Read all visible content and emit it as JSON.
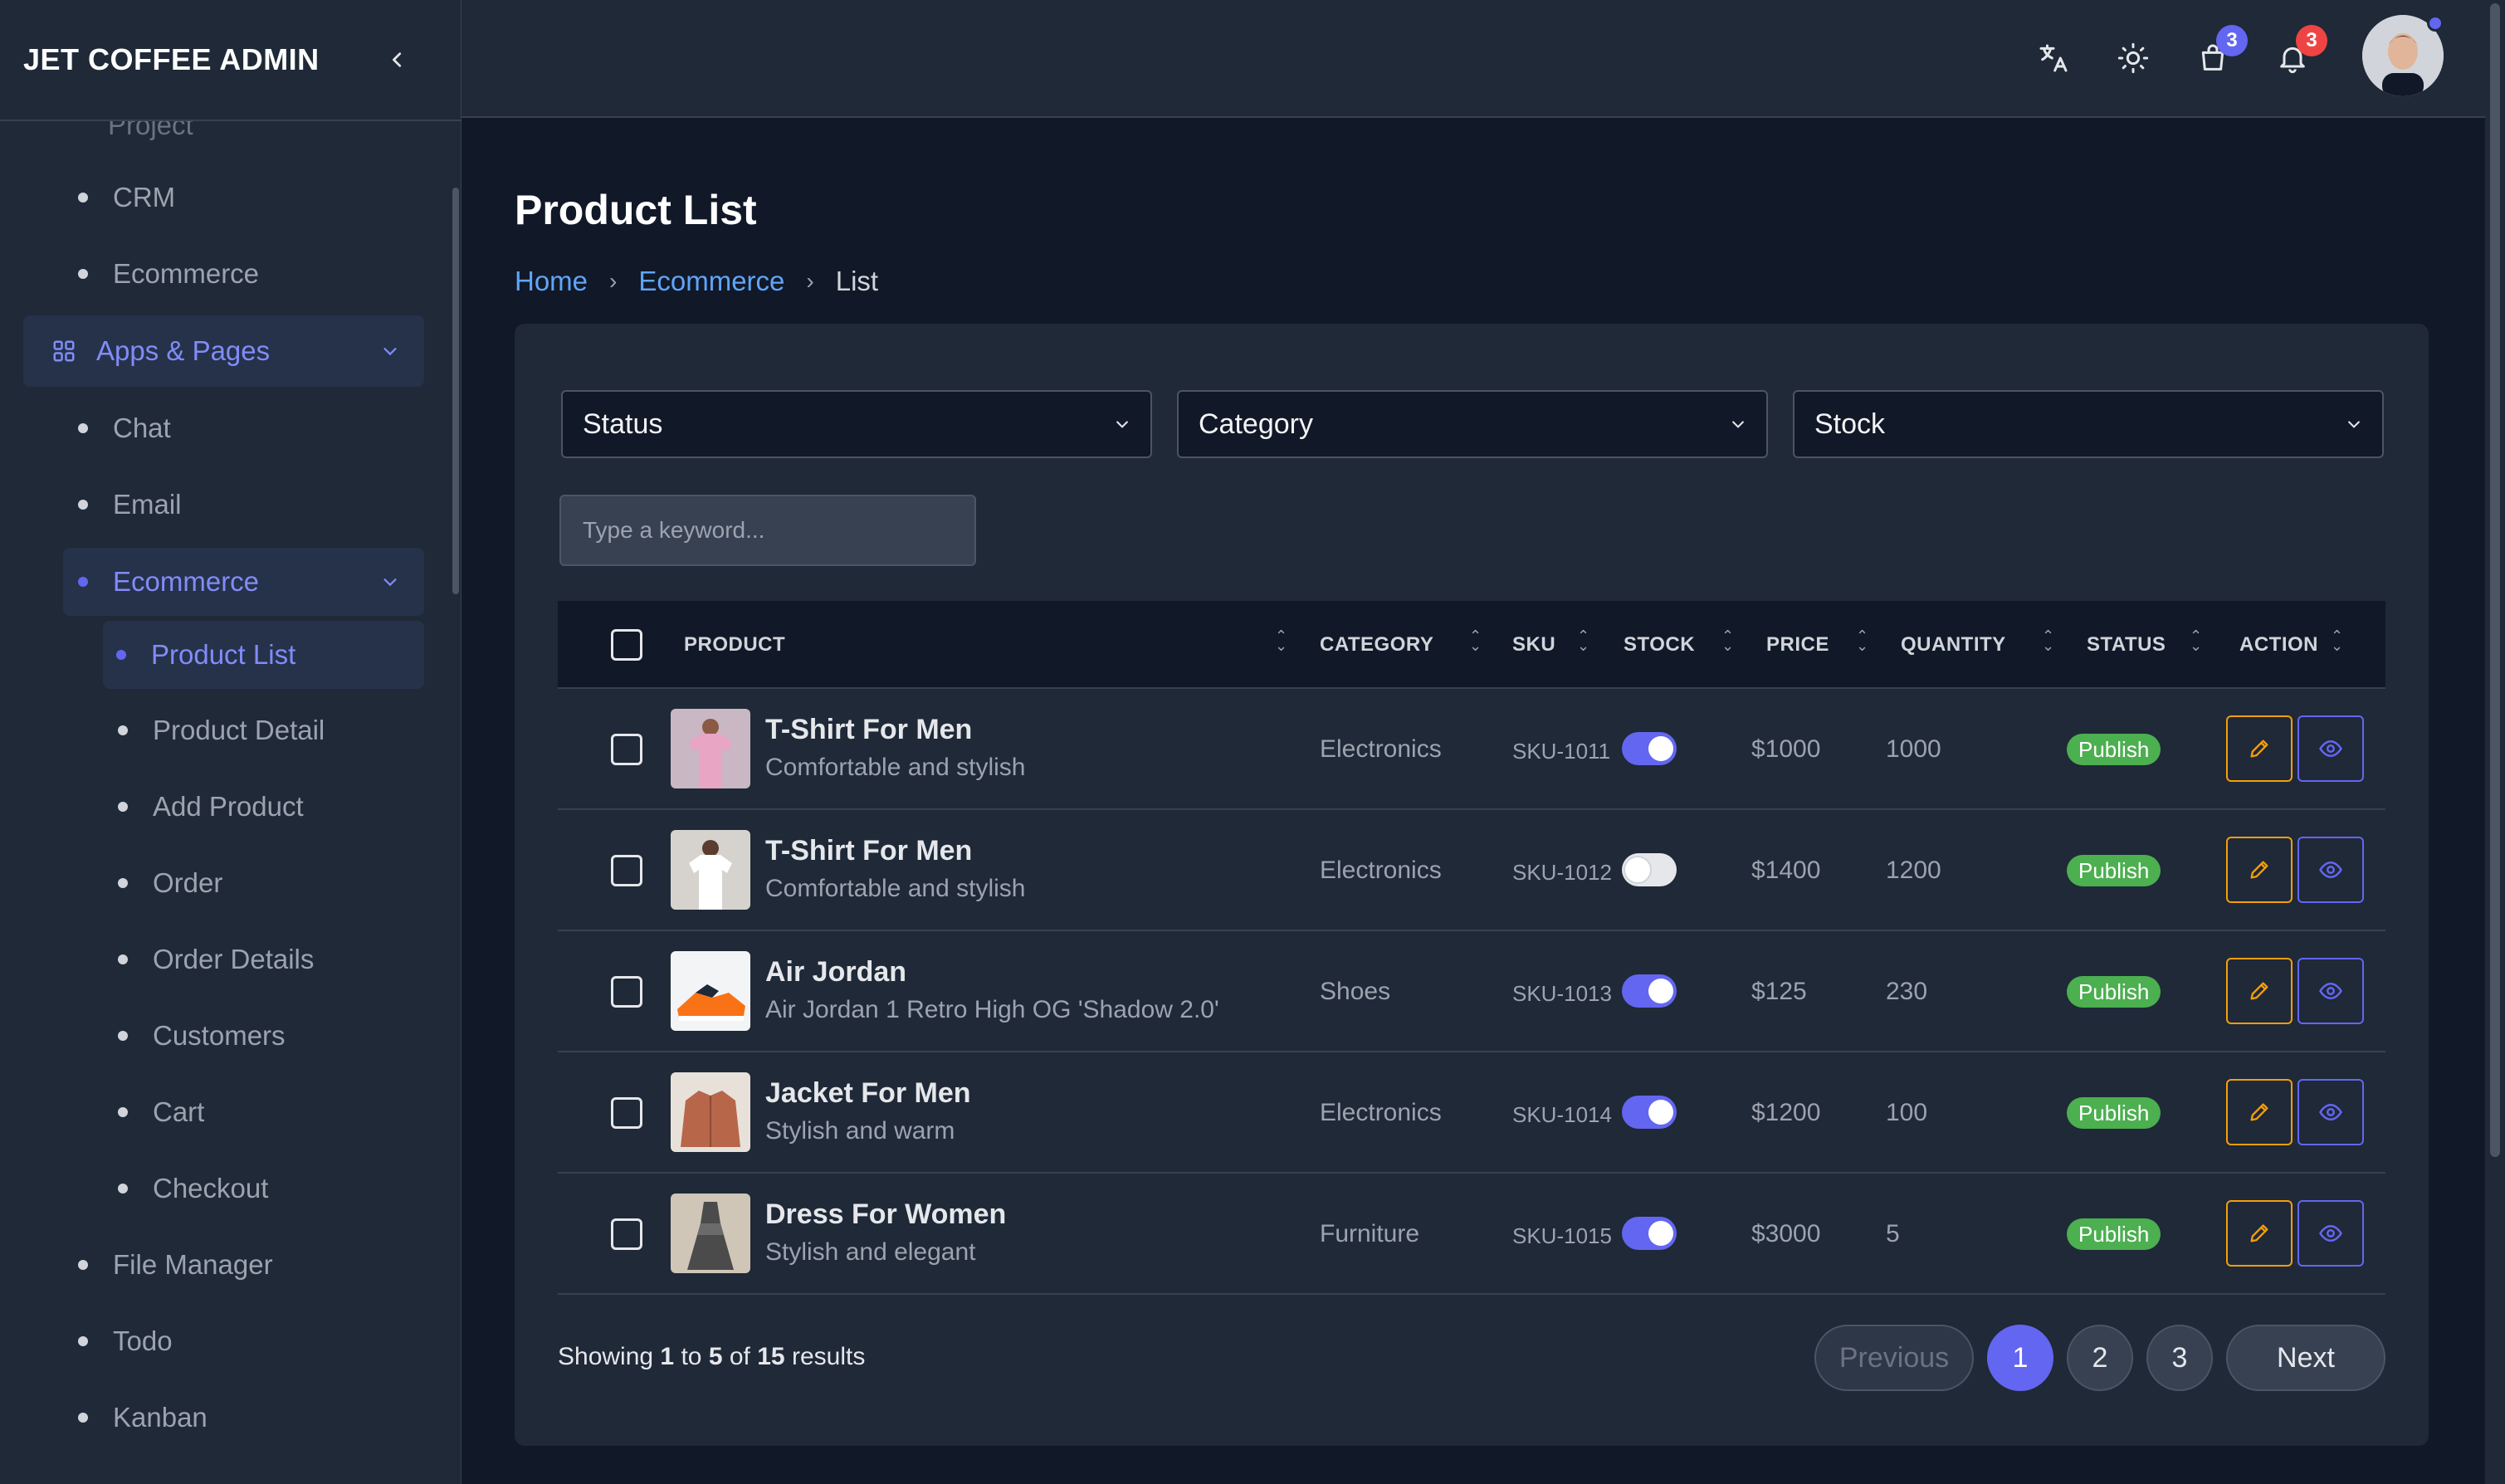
{
  "app": {
    "brand": "JET COFFEE ADMIN"
  },
  "sidebar": {
    "partial_top": "Project",
    "items_top": [
      {
        "label": "CRM"
      },
      {
        "label": "Ecommerce"
      }
    ],
    "group_apps": {
      "label": "Apps & Pages"
    },
    "items_apps": [
      {
        "label": "Chat"
      },
      {
        "label": "Email"
      }
    ],
    "group_ecommerce": {
      "label": "Ecommerce"
    },
    "active_item": {
      "label": "Product List"
    },
    "items_ecommerce": [
      {
        "label": "Product Detail"
      },
      {
        "label": "Add Product"
      },
      {
        "label": "Order"
      },
      {
        "label": "Order Details"
      },
      {
        "label": "Customers"
      },
      {
        "label": "Cart"
      },
      {
        "label": "Checkout"
      }
    ],
    "items_bottom": [
      {
        "label": "File Manager"
      },
      {
        "label": "Todo"
      },
      {
        "label": "Kanban"
      }
    ]
  },
  "topbar": {
    "cart_count": "3",
    "notifications_count": "3",
    "icons": [
      "translate-icon",
      "sun-icon",
      "shopping-bag-icon",
      "bell-icon"
    ]
  },
  "page": {
    "title": "Product List",
    "breadcrumb": {
      "home": "Home",
      "section": "Ecommerce",
      "current": "List"
    }
  },
  "filters": {
    "status": "Status",
    "category": "Category",
    "stock": "Stock",
    "search_placeholder": "Type a keyword..."
  },
  "table": {
    "headers": {
      "product": "PRODUCT",
      "category": "CATEGORY",
      "sku": "SKU",
      "stock": "STOCK",
      "price": "PRICE",
      "quantity": "QUANTITY",
      "status": "STATUS",
      "action": "ACTION"
    },
    "rows": [
      {
        "name": "T-Shirt For Men",
        "desc": "Comfortable and stylish",
        "category": "Electronics",
        "sku": "SKU-1011",
        "stock_on": true,
        "price": "$1000",
        "quantity": "1000",
        "status": "Publish"
      },
      {
        "name": "T-Shirt For Men",
        "desc": "Comfortable and stylish",
        "category": "Electronics",
        "sku": "SKU-1012",
        "stock_on": false,
        "price": "$1400",
        "quantity": "1200",
        "status": "Publish"
      },
      {
        "name": "Air Jordan",
        "desc": "Air Jordan 1 Retro High OG 'Shadow 2.0'",
        "category": "Shoes",
        "sku": "SKU-1013",
        "stock_on": true,
        "price": "$125",
        "quantity": "230",
        "status": "Publish"
      },
      {
        "name": "Jacket For Men",
        "desc": "Stylish and warm",
        "category": "Electronics",
        "sku": "SKU-1014",
        "stock_on": true,
        "price": "$1200",
        "quantity": "100",
        "status": "Publish"
      },
      {
        "name": "Dress For Women",
        "desc": "Stylish and elegant",
        "category": "Furniture",
        "sku": "SKU-1015",
        "stock_on": true,
        "price": "$3000",
        "quantity": "5",
        "status": "Publish"
      }
    ]
  },
  "pagination": {
    "showing_prefix": "Showing",
    "from": "1",
    "to_word": "to",
    "to": "5",
    "of_word": "of",
    "total": "15",
    "results_word": "results",
    "previous": "Previous",
    "pages": [
      "1",
      "2",
      "3"
    ],
    "next": "Next"
  },
  "colors": {
    "accent": "#6366f1",
    "link": "#60a5fa",
    "publish": "#4caf50",
    "edit": "#f59e0b"
  }
}
